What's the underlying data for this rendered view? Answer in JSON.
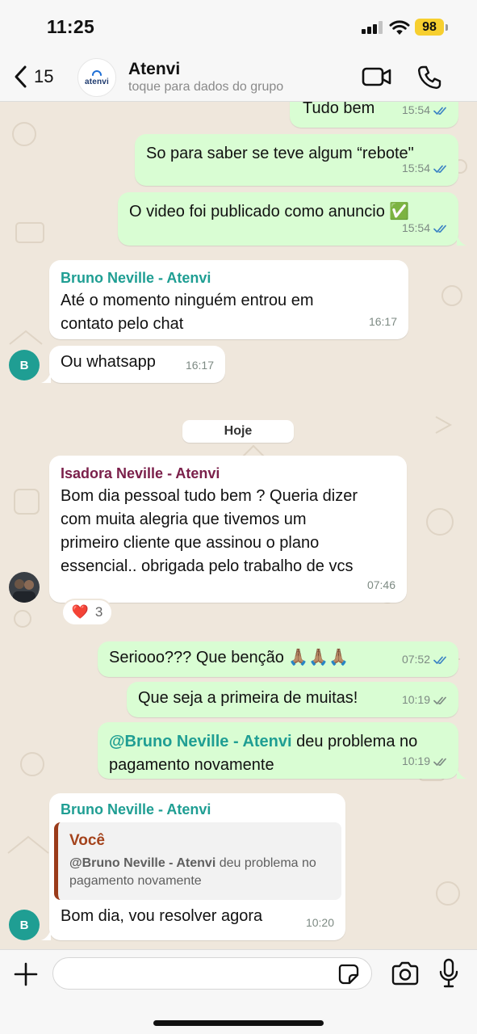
{
  "status_bar": {
    "time": "11:25",
    "battery": "98",
    "icons": [
      "signal-icon",
      "wifi-icon",
      "battery-icon"
    ]
  },
  "header": {
    "back_count": "15",
    "avatar_logo_text": "atenvi",
    "title": "Atenvi",
    "subtitle": "toque para dados do grupo",
    "icons": [
      "back-chevron-icon",
      "video-call-icon",
      "phone-icon"
    ]
  },
  "messages": [
    {
      "direction": "out",
      "text": "Tudo bem",
      "time": "15:54",
      "status": "read"
    },
    {
      "direction": "out",
      "text": "So para saber se teve algum “rebote\"",
      "time": "15:54",
      "status": "read"
    },
    {
      "direction": "out",
      "text": "O video foi publicado como anuncio ✅",
      "time": "15:54",
      "status": "read"
    },
    {
      "direction": "in",
      "sender": "Bruno Neville - Atenvi",
      "lines": [
        "Até o momento ninguém entrou em",
        "contato pelo chat"
      ],
      "time": "16:17"
    },
    {
      "direction": "in",
      "text": "Ou whatsapp",
      "time": "16:17",
      "avatar": "B"
    },
    {
      "direction": "in",
      "sender": "Isadora Neville - Atenvi",
      "lines": [
        "Bom dia pessoal tudo bem ? Queria dizer",
        "com muita alegria que tivemos um",
        "primeiro cliente que assinou o plano",
        "essencial.. obrigada pelo trabalho de vcs"
      ],
      "time": "07:46",
      "reaction": {
        "emoji": "❤️",
        "count": "3"
      }
    },
    {
      "direction": "out",
      "text": "Seriooo??? Que benção 🙏🏽🙏🏽🙏🏽",
      "time": "07:52",
      "status": "read"
    },
    {
      "direction": "out",
      "text": "Que seja a primeira de muitas!",
      "time": "10:19",
      "status": "delivered"
    },
    {
      "direction": "out",
      "mention": "@Bruno Neville - Atenvi",
      "line1_rest": " deu problema no",
      "line2": "pagamento novamente",
      "time": "10:19",
      "status": "delivered"
    },
    {
      "direction": "in",
      "sender": "Bruno Neville - Atenvi",
      "quote": {
        "sender": "Você",
        "mention": "@Bruno Neville - Atenvi",
        "line1_rest": " deu problema no",
        "line2": "pagamento novamente"
      },
      "text": "Bom dia, vou resolver agora",
      "time": "10:20",
      "avatar": "B"
    }
  ],
  "date_divider": "Hoje",
  "input_bar": {
    "placeholder": "",
    "icons": [
      "plus-icon",
      "sticker-icon",
      "camera-icon",
      "microphone-icon"
    ]
  },
  "colors": {
    "wallpaper": "#efe7dc",
    "outgoing_bubble": "#d9fdd3",
    "incoming_bubble": "#ffffff",
    "sender_teal": "#1f9e93",
    "sender_plum": "#7a1f4a",
    "read_tick": "#3b82c4",
    "battery": "#f7cf2f"
  }
}
